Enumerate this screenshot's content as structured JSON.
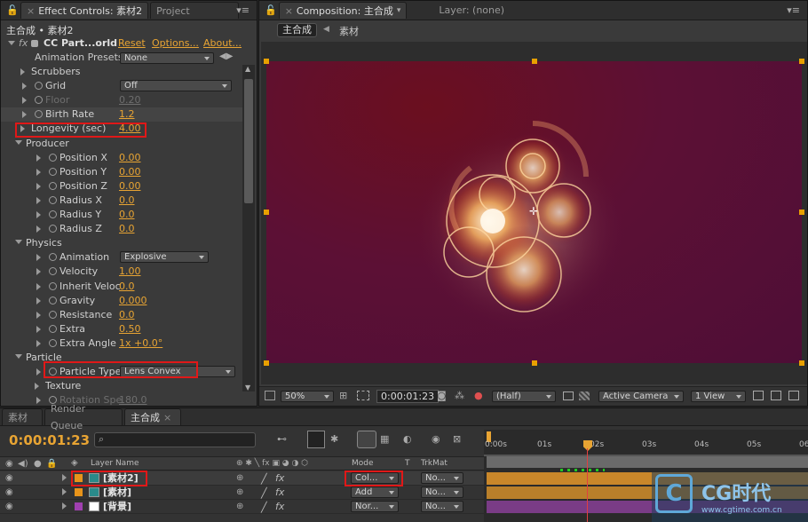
{
  "effect_controls": {
    "tabs": [
      {
        "label": "Effect Controls: 素材2"
      },
      {
        "label": "Project"
      }
    ],
    "breadcrumb": "主合成 • 素材2",
    "effect_name": "CC Part...orld",
    "links": {
      "reset": "Reset",
      "options": "Options...",
      "about": "About..."
    },
    "animation_presets": {
      "label": "Animation Presets:",
      "value": "None"
    },
    "rows": [
      {
        "label": "Scrubbers",
        "indent": 1,
        "type": "group"
      },
      {
        "label": "Grid",
        "indent": 2,
        "value": "Off",
        "type": "dropdown"
      },
      {
        "label": "Floor",
        "indent": 2,
        "value": "0.20",
        "type": "dim"
      },
      {
        "label": "Birth Rate",
        "indent": 2,
        "value": "1.2",
        "type": "value"
      },
      {
        "label": "Longevity (sec)",
        "indent": 1,
        "value": "4.00",
        "type": "value"
      },
      {
        "label": "Producer",
        "indent": 0,
        "type": "open"
      },
      {
        "label": "Position X",
        "indent": 3,
        "value": "0.00",
        "type": "value"
      },
      {
        "label": "Position Y",
        "indent": 3,
        "value": "0.00",
        "type": "value"
      },
      {
        "label": "Position Z",
        "indent": 3,
        "value": "0.00",
        "type": "value"
      },
      {
        "label": "Radius X",
        "indent": 3,
        "value": "0.0",
        "type": "value"
      },
      {
        "label": "Radius Y",
        "indent": 3,
        "value": "0.0",
        "type": "value"
      },
      {
        "label": "Radius Z",
        "indent": 3,
        "value": "0.0",
        "type": "value"
      },
      {
        "label": "Physics",
        "indent": 0,
        "type": "open"
      },
      {
        "label": "Animation",
        "indent": 3,
        "value": "Explosive",
        "type": "dropdown"
      },
      {
        "label": "Velocity",
        "indent": 3,
        "value": "1.00",
        "type": "value"
      },
      {
        "label": "Inherit Veloc",
        "indent": 3,
        "value": "0.0",
        "type": "value"
      },
      {
        "label": "Gravity",
        "indent": 3,
        "value": "0.000",
        "type": "value"
      },
      {
        "label": "Resistance",
        "indent": 3,
        "value": "0.0",
        "type": "value"
      },
      {
        "label": "Extra",
        "indent": 3,
        "value": "0.50",
        "type": "value"
      },
      {
        "label": "Extra Angle",
        "indent": 3,
        "value": "1x +0.0°",
        "type": "value"
      },
      {
        "label": "Particle",
        "indent": 0,
        "type": "open"
      },
      {
        "label": "Particle Type",
        "indent": 3,
        "value": "Lens Convex",
        "type": "dropdown"
      },
      {
        "label": "Texture",
        "indent": 2,
        "type": "group"
      },
      {
        "label": "Rotation Spe",
        "indent": 3,
        "value": "180.0",
        "type": "dim"
      }
    ]
  },
  "composition": {
    "tabs": [
      {
        "label": "Composition: 主合成"
      },
      {
        "label": "Layer: (none)"
      }
    ],
    "crumbs": [
      "主合成",
      "素材"
    ],
    "footer": {
      "zoom": "50%",
      "timecode": "0:00:01:23",
      "resolution": "(Half)",
      "camera": "Active Camera",
      "views": "1 View"
    },
    "bg_color": "#5c1035"
  },
  "timeline": {
    "tabs": [
      {
        "label": "素材"
      },
      {
        "label": "Render Queue"
      },
      {
        "label": "主合成"
      }
    ],
    "timecode": "0:00:01:23",
    "headers": {
      "layer_name": "Layer Name",
      "mode": "Mode",
      "t": "T",
      "trkmat": "TrkMat"
    },
    "layers": [
      {
        "num": "1",
        "name": "[素材2]",
        "mode": "Col...",
        "trk": "No...",
        "color": "#e8941a",
        "bar": "#c9872a"
      },
      {
        "num": "2",
        "name": "[素材]",
        "mode": "Add",
        "trk": "No...",
        "color": "#e8941a",
        "bar": "#b97f2a"
      },
      {
        "num": "3",
        "name": "[背景]",
        "mode": "Nor...",
        "trk": "No...",
        "color": "#a040b0",
        "bar": "#7a3c86"
      }
    ],
    "ruler": [
      "0:00s",
      "01s",
      "02s",
      "03s",
      "04s",
      "05s",
      "06s"
    ]
  },
  "watermark": {
    "brand": "CG时代",
    "url": "www.cgtime.com.cn"
  }
}
